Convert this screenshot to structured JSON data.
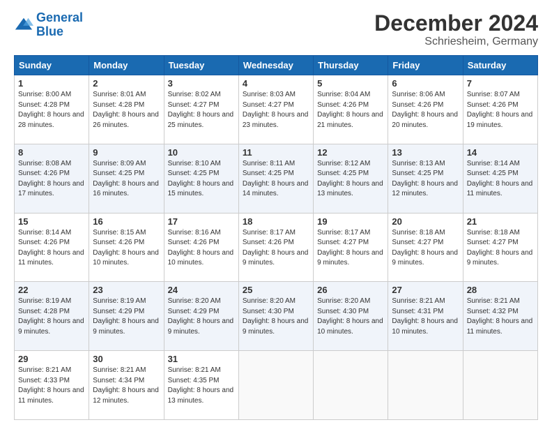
{
  "header": {
    "logo_line1": "General",
    "logo_line2": "Blue",
    "title": "December 2024",
    "subtitle": "Schriesheim, Germany"
  },
  "days_of_week": [
    "Sunday",
    "Monday",
    "Tuesday",
    "Wednesday",
    "Thursday",
    "Friday",
    "Saturday"
  ],
  "weeks": [
    [
      {
        "day": "1",
        "sunrise": "8:00 AM",
        "sunset": "4:28 PM",
        "daylight": "8 hours and 28 minutes."
      },
      {
        "day": "2",
        "sunrise": "8:01 AM",
        "sunset": "4:28 PM",
        "daylight": "8 hours and 26 minutes."
      },
      {
        "day": "3",
        "sunrise": "8:02 AM",
        "sunset": "4:27 PM",
        "daylight": "8 hours and 25 minutes."
      },
      {
        "day": "4",
        "sunrise": "8:03 AM",
        "sunset": "4:27 PM",
        "daylight": "8 hours and 23 minutes."
      },
      {
        "day": "5",
        "sunrise": "8:04 AM",
        "sunset": "4:26 PM",
        "daylight": "8 hours and 21 minutes."
      },
      {
        "day": "6",
        "sunrise": "8:06 AM",
        "sunset": "4:26 PM",
        "daylight": "8 hours and 20 minutes."
      },
      {
        "day": "7",
        "sunrise": "8:07 AM",
        "sunset": "4:26 PM",
        "daylight": "8 hours and 19 minutes."
      }
    ],
    [
      {
        "day": "8",
        "sunrise": "8:08 AM",
        "sunset": "4:26 PM",
        "daylight": "8 hours and 17 minutes."
      },
      {
        "day": "9",
        "sunrise": "8:09 AM",
        "sunset": "4:25 PM",
        "daylight": "8 hours and 16 minutes."
      },
      {
        "day": "10",
        "sunrise": "8:10 AM",
        "sunset": "4:25 PM",
        "daylight": "8 hours and 15 minutes."
      },
      {
        "day": "11",
        "sunrise": "8:11 AM",
        "sunset": "4:25 PM",
        "daylight": "8 hours and 14 minutes."
      },
      {
        "day": "12",
        "sunrise": "8:12 AM",
        "sunset": "4:25 PM",
        "daylight": "8 hours and 13 minutes."
      },
      {
        "day": "13",
        "sunrise": "8:13 AM",
        "sunset": "4:25 PM",
        "daylight": "8 hours and 12 minutes."
      },
      {
        "day": "14",
        "sunrise": "8:14 AM",
        "sunset": "4:25 PM",
        "daylight": "8 hours and 11 minutes."
      }
    ],
    [
      {
        "day": "15",
        "sunrise": "8:14 AM",
        "sunset": "4:26 PM",
        "daylight": "8 hours and 11 minutes."
      },
      {
        "day": "16",
        "sunrise": "8:15 AM",
        "sunset": "4:26 PM",
        "daylight": "8 hours and 10 minutes."
      },
      {
        "day": "17",
        "sunrise": "8:16 AM",
        "sunset": "4:26 PM",
        "daylight": "8 hours and 10 minutes."
      },
      {
        "day": "18",
        "sunrise": "8:17 AM",
        "sunset": "4:26 PM",
        "daylight": "8 hours and 9 minutes."
      },
      {
        "day": "19",
        "sunrise": "8:17 AM",
        "sunset": "4:27 PM",
        "daylight": "8 hours and 9 minutes."
      },
      {
        "day": "20",
        "sunrise": "8:18 AM",
        "sunset": "4:27 PM",
        "daylight": "8 hours and 9 minutes."
      },
      {
        "day": "21",
        "sunrise": "8:18 AM",
        "sunset": "4:27 PM",
        "daylight": "8 hours and 9 minutes."
      }
    ],
    [
      {
        "day": "22",
        "sunrise": "8:19 AM",
        "sunset": "4:28 PM",
        "daylight": "8 hours and 9 minutes."
      },
      {
        "day": "23",
        "sunrise": "8:19 AM",
        "sunset": "4:29 PM",
        "daylight": "8 hours and 9 minutes."
      },
      {
        "day": "24",
        "sunrise": "8:20 AM",
        "sunset": "4:29 PM",
        "daylight": "8 hours and 9 minutes."
      },
      {
        "day": "25",
        "sunrise": "8:20 AM",
        "sunset": "4:30 PM",
        "daylight": "8 hours and 9 minutes."
      },
      {
        "day": "26",
        "sunrise": "8:20 AM",
        "sunset": "4:30 PM",
        "daylight": "8 hours and 10 minutes."
      },
      {
        "day": "27",
        "sunrise": "8:21 AM",
        "sunset": "4:31 PM",
        "daylight": "8 hours and 10 minutes."
      },
      {
        "day": "28",
        "sunrise": "8:21 AM",
        "sunset": "4:32 PM",
        "daylight": "8 hours and 11 minutes."
      }
    ],
    [
      {
        "day": "29",
        "sunrise": "8:21 AM",
        "sunset": "4:33 PM",
        "daylight": "8 hours and 11 minutes."
      },
      {
        "day": "30",
        "sunrise": "8:21 AM",
        "sunset": "4:34 PM",
        "daylight": "8 hours and 12 minutes."
      },
      {
        "day": "31",
        "sunrise": "8:21 AM",
        "sunset": "4:35 PM",
        "daylight": "8 hours and 13 minutes."
      },
      null,
      null,
      null,
      null
    ]
  ]
}
